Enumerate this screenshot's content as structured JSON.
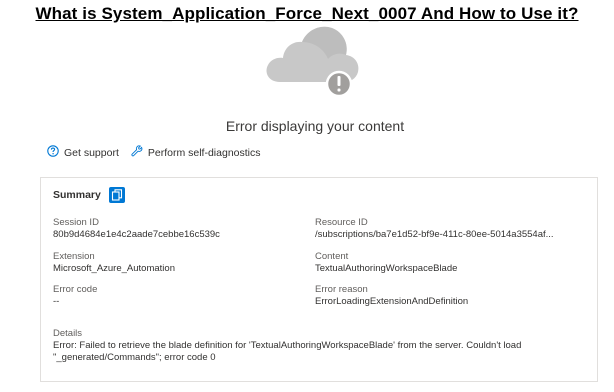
{
  "headline": "What is System_Application_Force_Next_0007 And How to Use it?",
  "error": {
    "title": "Error displaying your content"
  },
  "actions": {
    "support_label": "Get support",
    "diagnostics_label": "Perform self-diagnostics"
  },
  "summary": {
    "title": "Summary",
    "fields": {
      "session_id_label": "Session ID",
      "session_id_value": "80b9d4684e1e4c2aade7cebbe16c539c",
      "resource_id_label": "Resource ID",
      "resource_id_value": "/subscriptions/ba7e1d52-bf9e-411c-80ee-5014a3554af...",
      "extension_label": "Extension",
      "extension_value": "Microsoft_Azure_Automation",
      "content_label": "Content",
      "content_value": "TextualAuthoringWorkspaceBlade",
      "error_code_label": "Error code",
      "error_code_value": "--",
      "error_reason_label": "Error reason",
      "error_reason_value": "ErrorLoadingExtensionAndDefinition"
    },
    "details_label": "Details",
    "details_line1": "Error: Failed to retrieve the blade definition for 'TextualAuthoringWorkspaceBlade' from the server. Couldn't load",
    "details_line2": "\"_generated/Commands\"; error code 0"
  },
  "colors": {
    "accent": "#0078d4",
    "cloud": "#c8c8c8",
    "alert_badge": "#a19f9d"
  },
  "icons": [
    "cloud-error-icon",
    "question-circle-icon",
    "wrench-icon",
    "copy-icon"
  ]
}
